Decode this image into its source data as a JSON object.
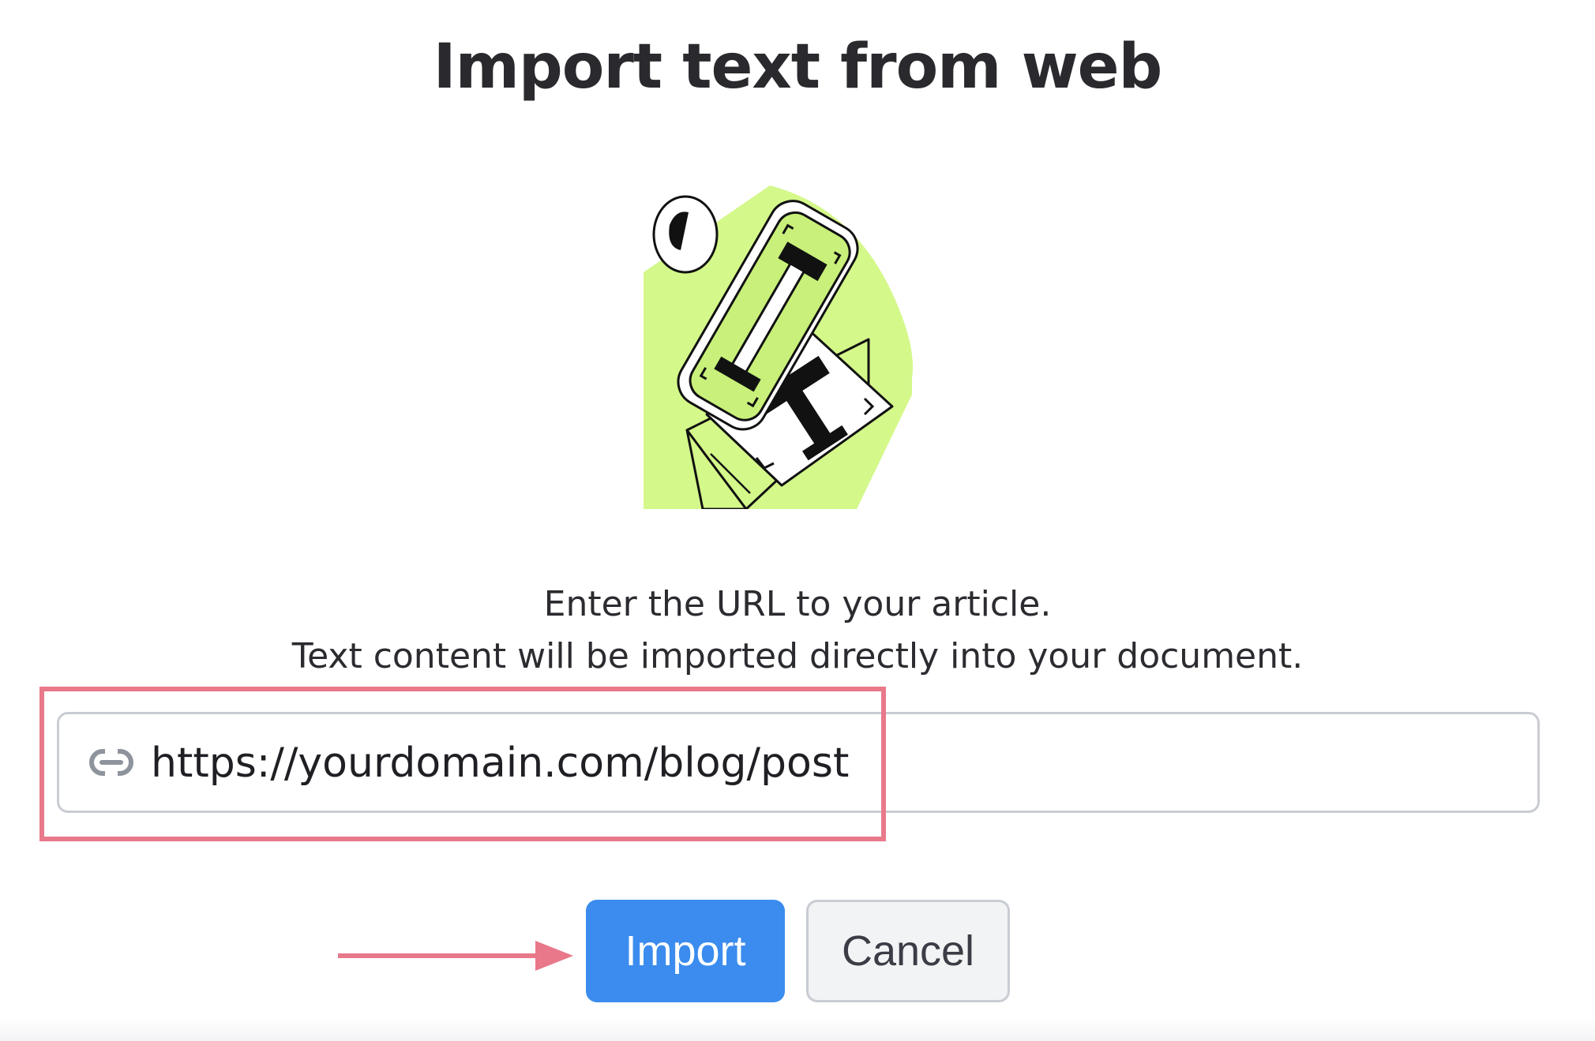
{
  "dialog": {
    "title": "Import text from web",
    "description_line1": "Enter the URL to your article.",
    "description_line2": "Text content will be imported directly into your document.",
    "url_input": {
      "value": "https://yourdomain.com/blog/post",
      "icon": "link-icon"
    },
    "import_label": "Import",
    "cancel_label": "Cancel"
  },
  "colors": {
    "accent": "#3b8cee",
    "highlight": "#e8788a",
    "illustration_green": "#d4f88a"
  }
}
